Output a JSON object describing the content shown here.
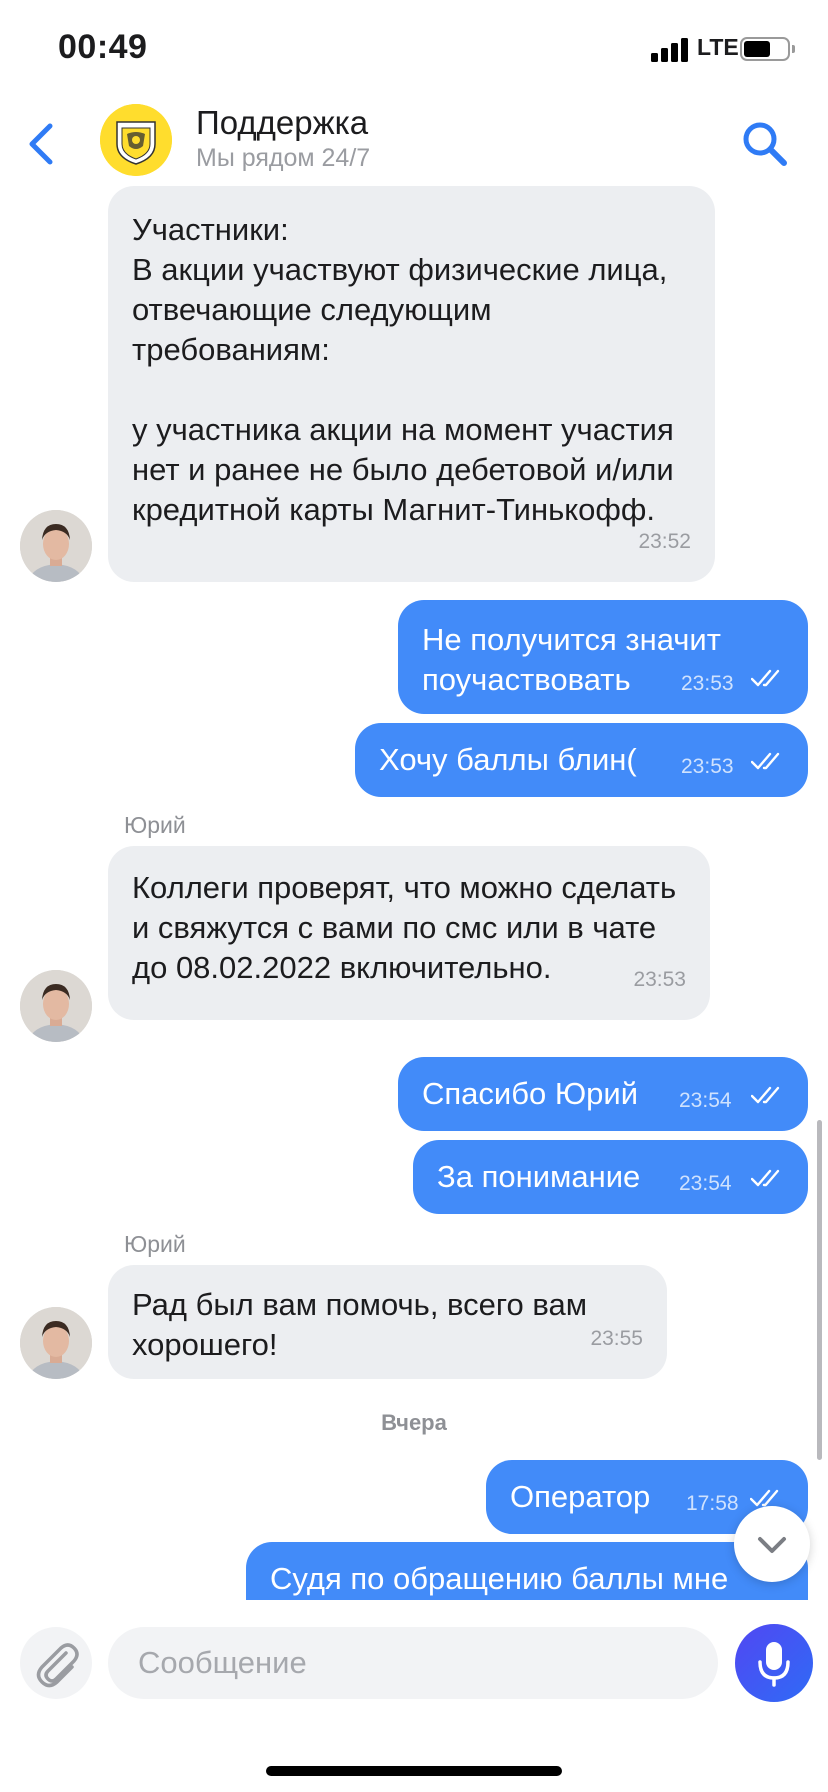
{
  "status_bar": {
    "time": "00:49",
    "network": "LTE",
    "battery_fraction": 0.62
  },
  "header": {
    "title": "Поддержка",
    "subtitle": "Мы рядом 24/7"
  },
  "messages": [
    {
      "dir": "in",
      "text": "Участники:\nВ акции участвуют физические лица, отвечающие следующим требованиям:\n\nу участника акции на момент участия нет и ранее не было дебетовой и/или кредитной карты Магнит-Тинькофф.",
      "time": "23:52"
    },
    {
      "dir": "out",
      "text": "Не получится значит поучаствовать",
      "time": "23:53",
      "status": "read"
    },
    {
      "dir": "out",
      "text": "Хочу баллы блин(",
      "time": "23:53",
      "status": "read"
    },
    {
      "dir": "in",
      "sender": "Юрий",
      "text": "Коллеги проверят, что можно сделать и свяжутся с вами по смс или в чате до 08.02.2022 включительно.",
      "time": "23:53"
    },
    {
      "dir": "out",
      "text": "Спасибо Юрий",
      "time": "23:54",
      "status": "read"
    },
    {
      "dir": "out",
      "text": "За понимание",
      "time": "23:54",
      "status": "read"
    },
    {
      "dir": "in",
      "sender": "Юрий",
      "text": "Рад был вам помочь, всего вам хорошего!",
      "time": "23:55"
    },
    {
      "dir": "out",
      "text": "Оператор",
      "time": "17:58",
      "status": "read"
    },
    {
      "dir": "out",
      "text": "Судя по обращению баллы мне"
    }
  ],
  "day_divider": "Вчера",
  "composer": {
    "placeholder": "Сообщение"
  },
  "colors": {
    "accent": "#428bf9",
    "incoming_bubble": "#eceef1",
    "brand_yellow": "#ffdd2d",
    "mic_gradient_start": "#5147f2"
  },
  "icons": [
    "back-chevron-icon",
    "tinkoff-logo-icon",
    "search-icon",
    "paperclip-icon",
    "microphone-icon",
    "chevron-down-icon",
    "double-check-icon",
    "avatar-image"
  ]
}
